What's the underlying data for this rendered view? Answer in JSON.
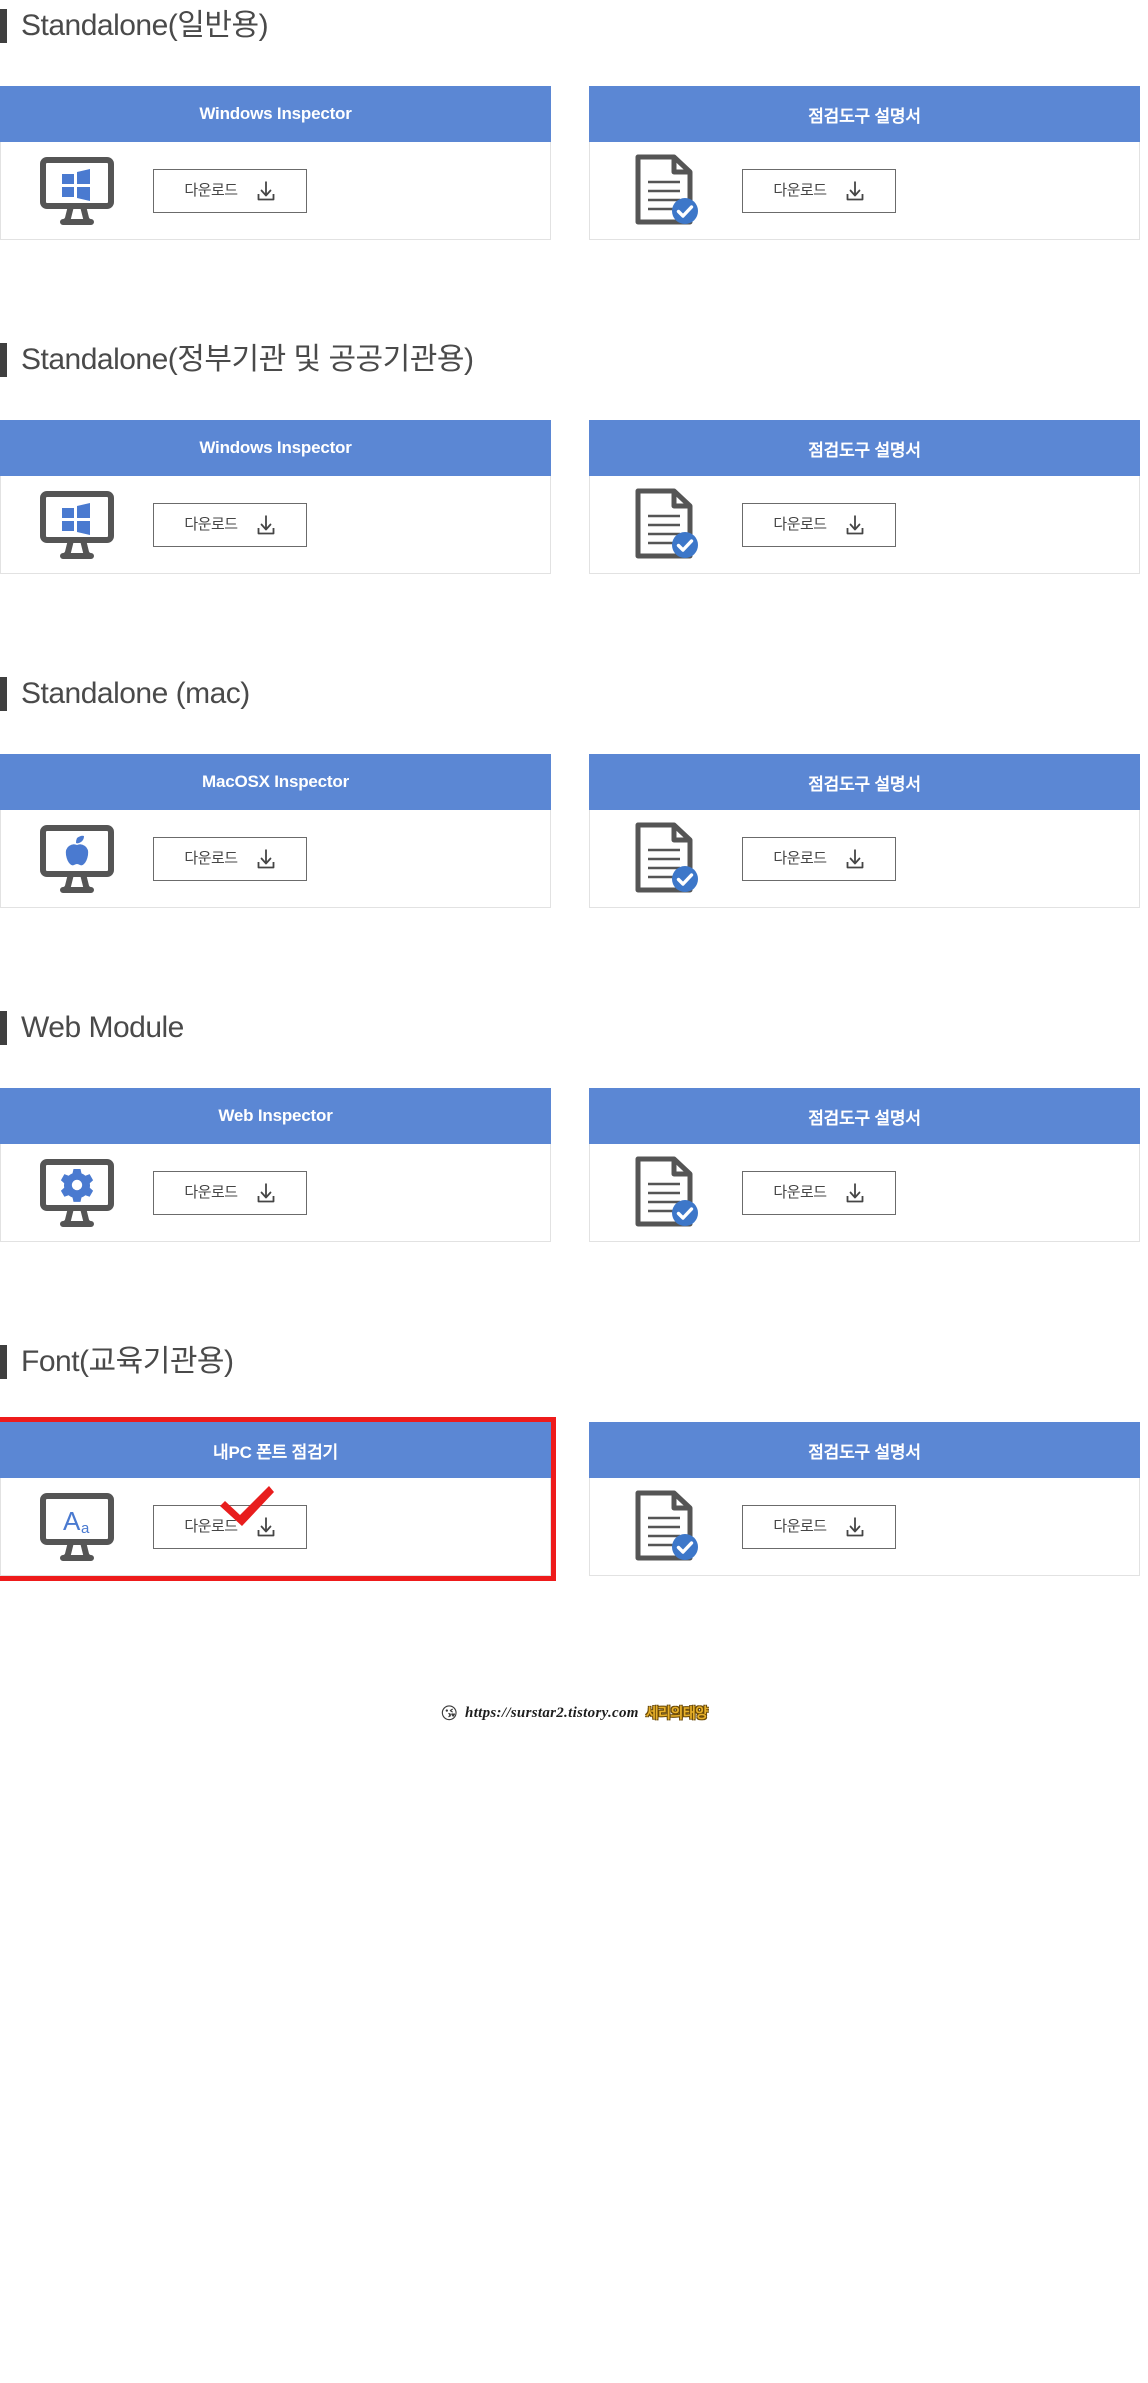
{
  "accent": {
    "header_blue": "#5b87d4",
    "icon_blue": "#4a7ad0",
    "highlight_red": "#ee1b1b",
    "heading_gray": "#4a4a4a",
    "outline_gray": "#555555"
  },
  "download_label": "다운로드",
  "manual_title": "점검도구 설명서",
  "sections": [
    {
      "heading": "Standalone(일반용)",
      "cards": [
        {
          "title": "Windows Inspector",
          "icon": "monitor-windows-icon",
          "button": "다운로드",
          "highlight": false
        },
        {
          "title": "점검도구 설명서",
          "icon": "document-check-icon",
          "button": "다운로드",
          "highlight": false
        }
      ]
    },
    {
      "heading": "Standalone(정부기관 및 공공기관용)",
      "cards": [
        {
          "title": "Windows Inspector",
          "icon": "monitor-windows-icon",
          "button": "다운로드",
          "highlight": false
        },
        {
          "title": "점검도구 설명서",
          "icon": "document-check-icon",
          "button": "다운로드",
          "highlight": false
        }
      ]
    },
    {
      "heading": "Standalone (mac)",
      "cards": [
        {
          "title": "MacOSX Inspector",
          "icon": "monitor-apple-icon",
          "button": "다운로드",
          "highlight": false
        },
        {
          "title": "점검도구 설명서",
          "icon": "document-check-icon",
          "button": "다운로드",
          "highlight": false
        }
      ]
    },
    {
      "heading": "Web Module",
      "cards": [
        {
          "title": "Web Inspector",
          "icon": "monitor-gear-icon",
          "button": "다운로드",
          "highlight": false
        },
        {
          "title": "점검도구 설명서",
          "icon": "document-check-icon",
          "button": "다운로드",
          "highlight": false
        }
      ]
    },
    {
      "heading": "Font(교육기관용)",
      "cards": [
        {
          "title": "내PC 폰트 점검기",
          "icon": "monitor-font-icon",
          "button": "다운로드",
          "highlight": true,
          "annotation": "red-check-mark"
        },
        {
          "title": "점검도구 설명서",
          "icon": "document-check-icon",
          "button": "다운로드",
          "highlight": false
        }
      ]
    }
  ],
  "watermark": {
    "emoji": "😘",
    "url": "https://surstar2.tistory.com",
    "name": "세리의태양"
  }
}
